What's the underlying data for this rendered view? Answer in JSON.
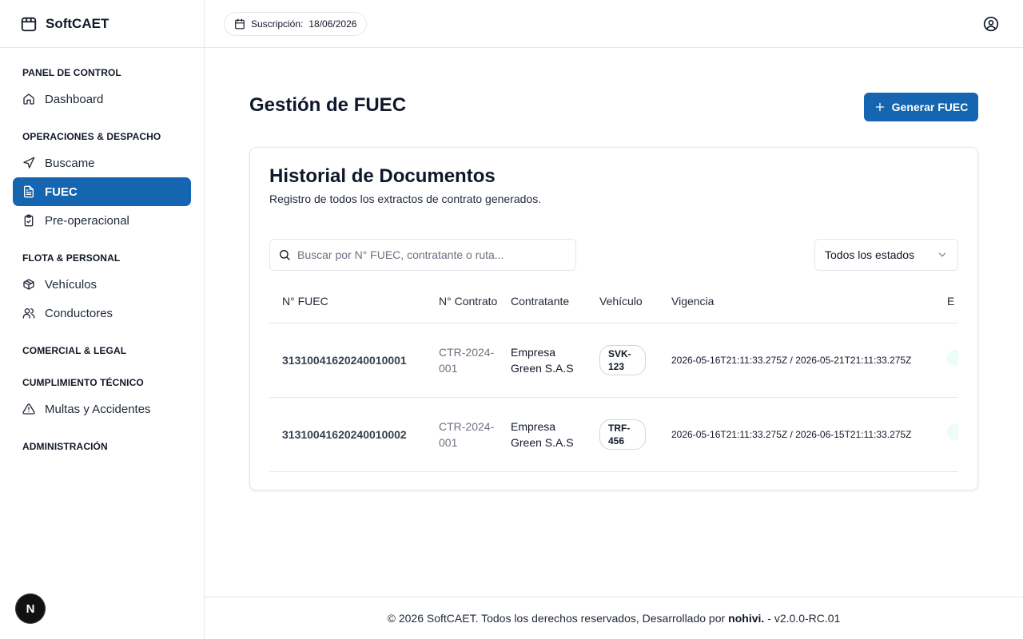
{
  "brand": {
    "name": "SoftCAET"
  },
  "sidebar": {
    "sections": [
      {
        "title": "PANEL DE CONTROL",
        "items": [
          {
            "label": "Dashboard",
            "icon": "home-icon"
          }
        ]
      },
      {
        "title": "OPERACIONES & DESPACHO",
        "items": [
          {
            "label": "Buscame",
            "icon": "navigation-icon"
          },
          {
            "label": "FUEC",
            "icon": "document-icon",
            "active": true
          },
          {
            "label": "Pre-operacional",
            "icon": "clipboard-icon"
          }
        ]
      },
      {
        "title": "FLOTA & PERSONAL",
        "items": [
          {
            "label": "Vehículos",
            "icon": "box-icon"
          },
          {
            "label": "Conductores",
            "icon": "users-icon"
          }
        ]
      },
      {
        "title": "COMERCIAL & LEGAL",
        "items": []
      },
      {
        "title": "CUMPLIMIENTO TÉCNICO",
        "items": [
          {
            "label": "Multas y Accidentes",
            "icon": "warning-icon"
          }
        ]
      },
      {
        "title": "ADMINISTRACIÓN",
        "items": []
      }
    ],
    "avatar_letter": "N"
  },
  "header": {
    "subscription_label": "Suscripción:",
    "subscription_date": "18/06/2026"
  },
  "main": {
    "title": "Gestión de FUEC",
    "generate_button": "Generar FUEC",
    "card": {
      "title": "Historial de Documentos",
      "subtitle": "Registro de todos los extractos de contrato generados.",
      "search_placeholder": "Buscar por N° FUEC, contratante o ruta...",
      "status_filter": "Todos los estados",
      "columns": [
        "N° FUEC",
        "N° Contrato",
        "Contratante",
        "Vehículo",
        "Vigencia",
        "E"
      ],
      "rows": [
        {
          "fuec": "31310041620240010001",
          "contrato": "CTR-2024-001",
          "contratante": "Empresa Green S.A.S",
          "vehiculo": "SVK-123",
          "vigencia": "2026-05-16T21:11:33.275Z / 2026-05-21T21:11:33.275Z"
        },
        {
          "fuec": "31310041620240010002",
          "contrato": "CTR-2024-001",
          "contratante": "Empresa Green S.A.S",
          "vehiculo": "TRF-456",
          "vigencia": "2026-05-16T21:11:33.275Z / 2026-06-15T21:11:33.275Z"
        }
      ]
    }
  },
  "footer": {
    "prefix": "© 2026 SoftCAET. Todos los derechos reservados, Desarrollado por",
    "author": "nohivi.",
    "suffix": "- v2.0.0-RC.01"
  },
  "colors": {
    "primary": "#1565b0",
    "border": "#e5e7eb",
    "muted": "#6b7280"
  }
}
